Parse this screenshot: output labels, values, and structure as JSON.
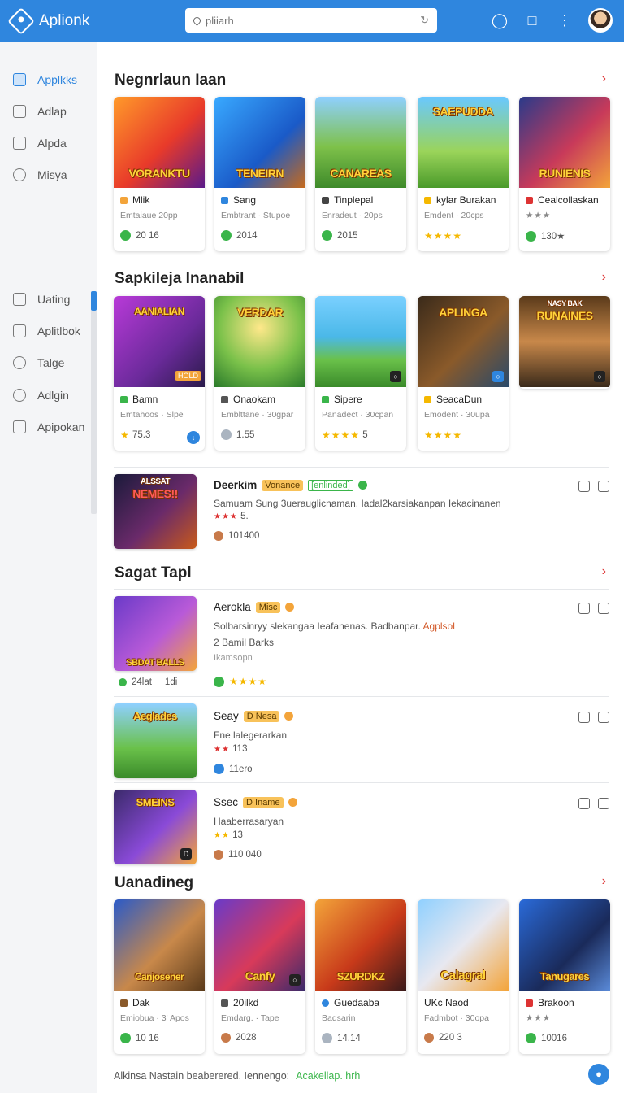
{
  "header": {
    "app_name": "Aplionk",
    "search_placeholder": "pliiarh",
    "search_value": ""
  },
  "sidebar": {
    "top_items": [
      {
        "label": "Applkks",
        "icon": "apps-icon",
        "active": true
      },
      {
        "label": "Adlap",
        "icon": "window-icon"
      },
      {
        "label": "Alpda",
        "icon": "camera-icon"
      },
      {
        "label": "Misya",
        "icon": "search-icon"
      }
    ],
    "bottom_items": [
      {
        "label": "Uating",
        "icon": "clipboard-icon"
      },
      {
        "label": "Aplitlbok",
        "icon": "square-icon"
      },
      {
        "label": "Talge",
        "icon": "gamepad-icon"
      },
      {
        "label": "Adlgin",
        "icon": "search-icon"
      },
      {
        "label": "Apipokan",
        "icon": "document-icon"
      }
    ]
  },
  "sections": {
    "s1": {
      "title": "Negnrlaun Iaan",
      "cards": [
        {
          "art": "VORANKTU",
          "name": "Mlik",
          "sub": "Emtaiaue 20pp",
          "foot": "20 16"
        },
        {
          "art": "TENEIRN",
          "name": "Sang",
          "sub": "Embtrant · Stupoe",
          "foot": "2014"
        },
        {
          "art": "CANAREAS",
          "name": "Tinplepal",
          "sub": "Enradeut · 20ps",
          "foot": "2015"
        },
        {
          "art": "SAEPUDDA",
          "name": "kylar Burakan",
          "sub": "Emdent · 20cps",
          "foot": "★★★★"
        },
        {
          "art": "RUNIENIS",
          "name": "Cealcollaskan",
          "sub": "★★★",
          "foot": "130★"
        }
      ]
    },
    "s2": {
      "title": "Sapkileja Inanabil",
      "cards": [
        {
          "art": "AANIALIAN",
          "name": "Bamn",
          "sub": "Emtahoos · Slpe",
          "foot": "75.3",
          "tag": "HOLD"
        },
        {
          "art": "VERDAR",
          "name": "Onaokam",
          "sub": "Emblttane · 30gpar",
          "foot": "1.55"
        },
        {
          "art": "",
          "name": "Sipere",
          "sub": "Panadect · 30cpan",
          "foot": "5"
        },
        {
          "art": "APLINGA",
          "name": "SeacaDun",
          "sub": "Emodent · 30upa",
          "foot": "★★★★"
        },
        {
          "art": "RUNAINES",
          "name": "",
          "sub": "",
          "foot": "",
          "tag": "NASY BAK"
        }
      ]
    },
    "feature": {
      "thumb_art": "NEMES!!",
      "thumb_top": "ALSSAT",
      "title": "Deerkim",
      "pill1": "Vonance",
      "pill2": "[enlinded]",
      "desc": "Samuam Sung 3uerauglicnaman. Iadal2karsiakanpan Iekacinanen",
      "rating": "5.",
      "downloads": "101400"
    },
    "s3": {
      "title": "Sagat Tapl",
      "rows": [
        {
          "art": "SBDAT BALLS",
          "title": "Aerokla",
          "pill": "Misc",
          "desc": "Solbarsinryy slekangaa Ieafanenas. Badbanpar.",
          "desc_link": "Agplsol",
          "line3": "2 Bamil Barks",
          "line4": "Ikamsopn",
          "foot_left": "24lat",
          "foot_right": "1di"
        },
        {
          "art": "Aeglades",
          "title": "Seay",
          "pill": "D Nesa",
          "desc": "Fne lalegerarkan",
          "rating": "113",
          "foot": "11ero"
        },
        {
          "art": "SMEINS",
          "title": "Ssec",
          "pill": "D Iname",
          "desc": "Haaberrasaryan",
          "rating": "13",
          "foot": "110 040"
        }
      ]
    },
    "s4": {
      "title": "Uanadineg",
      "cards": [
        {
          "art": "Canjosener",
          "name": "Dak",
          "sub": "Emiobua · 3' Apos",
          "foot": "10 16"
        },
        {
          "art": "Canfy",
          "name": "20ilkd",
          "sub": "Emdarg. · Tape",
          "foot": "2028"
        },
        {
          "art": "SZURDKZ",
          "name": "Guedaaba",
          "sub": "Badsarin",
          "foot": "14.14"
        },
        {
          "art": "Calagral",
          "name": "UKc Naod",
          "sub": "Fadmbot · 30opa",
          "foot": "220 3"
        },
        {
          "art": "Tanugares",
          "name": "Brakoon",
          "sub": "★★★",
          "foot": "10016"
        }
      ]
    }
  },
  "footer": {
    "text": "Alkinsa Nastain beaberered. Iennengo:",
    "link": "Acakellap. hrh"
  }
}
